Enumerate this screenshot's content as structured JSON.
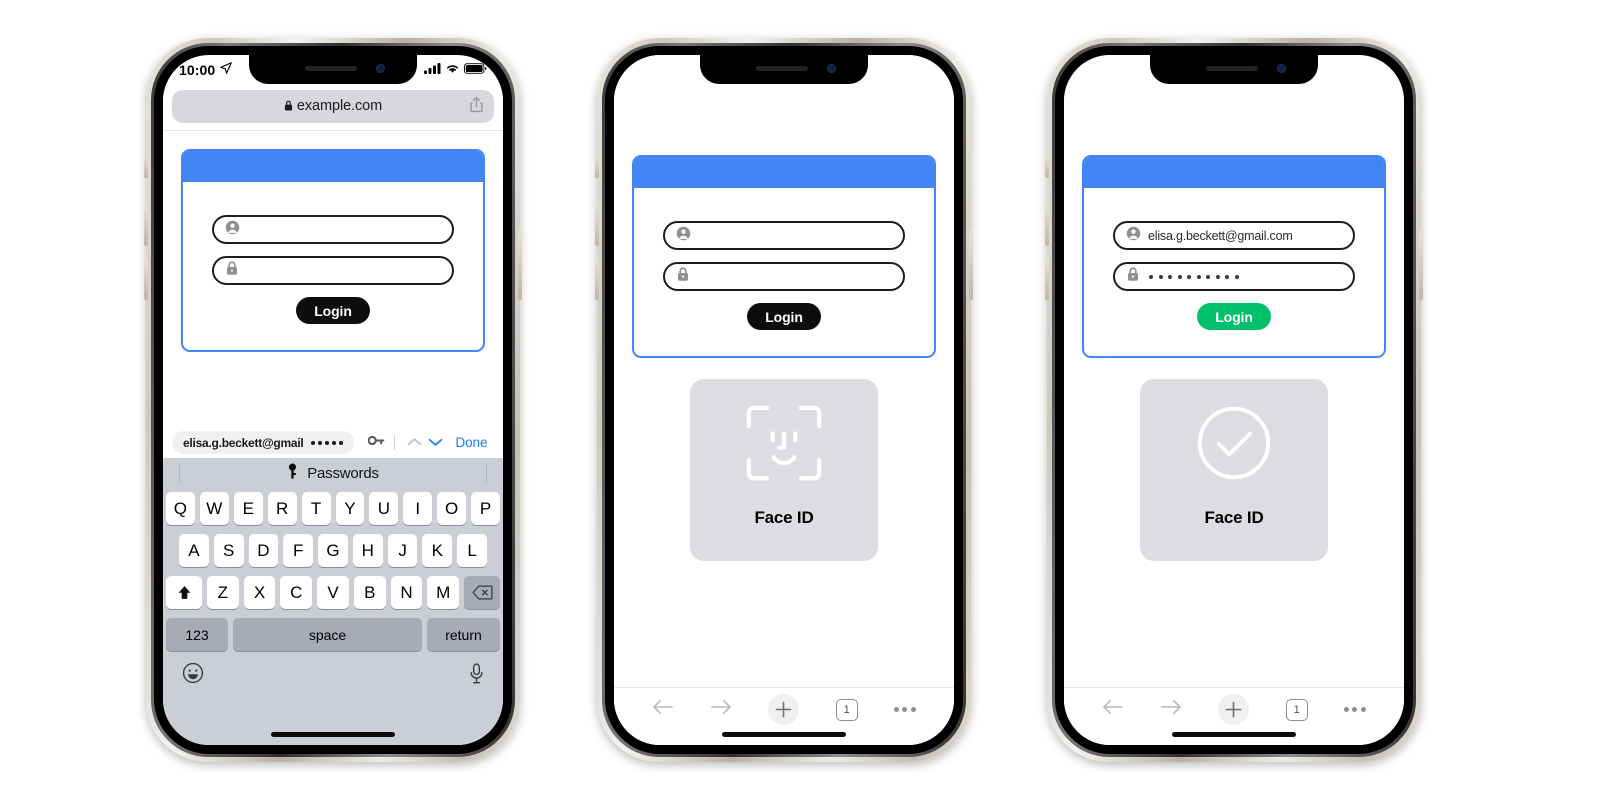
{
  "colors": {
    "brand_blue": "#4285f4",
    "link_blue": "#1a7ef3",
    "success_green": "#00c06a",
    "button_black": "#0d0d0f",
    "panel_gray": "#dcdde1",
    "keyboard_bg": "#cbced5"
  },
  "status_bar": {
    "time": "10:00",
    "location_icon": "location-arrow-icon",
    "cellular_icon": "cellular-bars-icon",
    "wifi_icon": "wifi-icon",
    "battery_icon": "battery-icon"
  },
  "url_bar": {
    "lock_icon": "lock-icon",
    "url": "example.com",
    "share_icon": "share-icon"
  },
  "phones": [
    {
      "id": "phone-1",
      "state": "keyboard-open",
      "login_card": {
        "username": {
          "icon": "person-icon",
          "value": "",
          "placeholder": ""
        },
        "password": {
          "icon": "lock-icon",
          "value": "",
          "dots": 0
        },
        "login_label": "Login",
        "login_color": "#0d0d0f"
      },
      "autofill": {
        "username": "elisa.g.beckett@gmail",
        "password_dots": 5,
        "key_icon": "key-icon",
        "up_icon": "chevron-up-icon",
        "down_icon": "chevron-down-icon",
        "done_label": "Done"
      },
      "keyboard": {
        "predictive_label": "Passwords",
        "predictive_icon": "key-icon",
        "row1": [
          "Q",
          "W",
          "E",
          "R",
          "T",
          "Y",
          "U",
          "I",
          "O",
          "P"
        ],
        "row2": [
          "A",
          "S",
          "D",
          "F",
          "G",
          "H",
          "J",
          "K",
          "L"
        ],
        "row3": [
          "Z",
          "X",
          "C",
          "V",
          "B",
          "N",
          "M"
        ],
        "shift_icon": "shift-arrow-icon",
        "backspace_icon": "backspace-icon",
        "numbers_label": "123",
        "space_label": "space",
        "return_label": "return",
        "emoji_icon": "emoji-smiley-icon",
        "mic_icon": "microphone-icon"
      }
    },
    {
      "id": "phone-2",
      "state": "faceid-scanning",
      "login_card": {
        "username": {
          "icon": "person-icon",
          "value": ""
        },
        "password": {
          "icon": "lock-icon",
          "value": "",
          "dots": 0
        },
        "login_label": "Login",
        "login_color": "#0d0d0f"
      },
      "faceid": {
        "icon": "face-id-scan-icon",
        "label": "Face ID"
      },
      "toolbar": {
        "back_icon": "arrow-back-icon",
        "forward_icon": "arrow-forward-icon",
        "new_tab_icon": "plus-icon",
        "tab_count": "1",
        "more_icon": "more-dots-icon"
      }
    },
    {
      "id": "phone-3",
      "state": "faceid-success",
      "login_card": {
        "username": {
          "icon": "person-icon",
          "value": "elisa.g.beckett@gmail.com"
        },
        "password": {
          "icon": "lock-icon",
          "value": "",
          "dots": 10
        },
        "login_label": "Login",
        "login_color": "#00c06a"
      },
      "faceid": {
        "icon": "check-circle-icon",
        "label": "Face ID"
      },
      "toolbar": {
        "back_icon": "arrow-back-icon",
        "forward_icon": "arrow-forward-icon",
        "new_tab_icon": "plus-icon",
        "tab_count": "1",
        "more_icon": "more-dots-icon"
      }
    }
  ]
}
